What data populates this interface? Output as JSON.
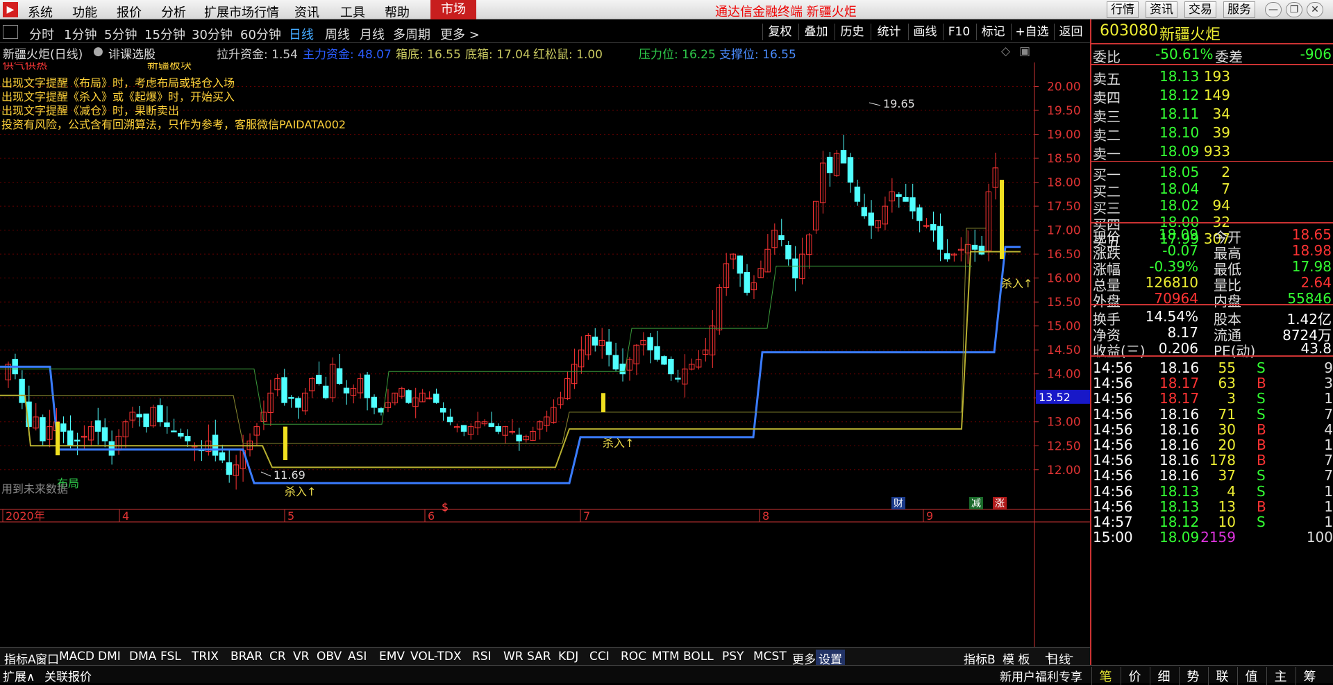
{
  "menubar": {
    "logo": "▶",
    "items": [
      "系统",
      "功能",
      "报价",
      "分析",
      "扩展市场行情",
      "资讯",
      "工具",
      "帮助"
    ],
    "market": "市场",
    "title": "通达信金融终端  新疆火炬",
    "right_buttons": [
      "行情",
      "资讯",
      "交易",
      "服务"
    ],
    "win_controls": [
      "—",
      "❐",
      "✕"
    ]
  },
  "periods": {
    "items": [
      "分时",
      "1分钟",
      "5分钟",
      "15分钟",
      "30分钟",
      "60分钟",
      "日线",
      "周线",
      "月线",
      "多周期",
      "更多 >"
    ],
    "active": "日线"
  },
  "tools": [
    "复权",
    "叠加",
    "历史",
    "统计",
    "画线",
    "F10",
    "标记",
    "+自选",
    "返回"
  ],
  "info": {
    "stock_name": "新疆火炬(日线)",
    "tag": "诽课选股",
    "items": [
      {
        "label": "拉升资金: 1.54",
        "color": "#cccccc"
      },
      {
        "label": "主力资金: 48.07",
        "color": "#2a5cff"
      },
      {
        "label": "箱底: 16.55",
        "color": "#c8c860"
      },
      {
        "label": "底箱: 17.04",
        "color": "#c8c860"
      },
      {
        "label": "红松鼠: 1.00",
        "color": "#c8c860"
      },
      {
        "label": "压力位: 16.25",
        "color": "#2ec84a"
      },
      {
        "label": "支撑位: 16.55",
        "color": "#4a8cff"
      }
    ],
    "sub1": "供气供热",
    "sub2": "新疆板块"
  },
  "notes": [
    "出现文字提醒《布局》时，考虑布局或轻仓入场",
    "出现文字提醒《杀入》或《起爆》时，开始买入",
    "出现文字提醒《减仓》时，果断卖出",
    "投资有风险，公式含有回溯算法，只作为参考，客服微信PAIDATA002"
  ],
  "chart_data": {
    "type": "candlestick",
    "yaxis_ticks": [
      "20.00",
      "19.50",
      "19.00",
      "18.50",
      "18.00",
      "17.50",
      "17.00",
      "16.50",
      "16.00",
      "15.50",
      "15.00",
      "14.50",
      "14.00",
      "13.50",
      "13.00",
      "12.50",
      "12.00"
    ],
    "ylim": [
      11.2,
      20.5
    ],
    "current_price_label": "13.52",
    "high_label": "19.65",
    "low_label": "11.69",
    "month_labels": [
      "2020年",
      "4",
      "5",
      "6",
      "7",
      "8",
      "9"
    ],
    "signals": [
      {
        "text": "布局",
        "color": "#2ec84a"
      },
      {
        "text": "杀入↑",
        "color": "#e8d84a"
      },
      {
        "text": "杀入↑",
        "color": "#e8d84a"
      },
      {
        "text": "杀入↑",
        "color": "#e8d84a"
      }
    ],
    "markers": [
      "财",
      "减",
      "涨"
    ],
    "future_note": "用到未来数据",
    "closes": [
      14.2,
      14.0,
      13.4,
      12.9,
      13.1,
      12.6,
      12.9,
      13.0,
      12.8,
      12.5,
      12.6,
      12.7,
      12.9,
      12.8,
      12.6,
      12.3,
      12.7,
      13.0,
      13.2,
      13.1,
      12.9,
      13.3,
      13.0,
      12.9,
      12.8,
      12.7,
      12.6,
      12.5,
      12.4,
      12.6,
      12.3,
      12.2,
      11.9,
      12.1,
      12.4,
      12.6,
      12.9,
      13.2,
      13.6,
      13.9,
      13.4,
      13.5,
      13.3,
      13.6,
      13.9,
      13.8,
      13.5,
      14.2,
      13.8,
      13.6,
      13.7,
      13.9,
      13.5,
      13.3,
      13.2,
      13.4,
      13.6,
      13.7,
      13.4,
      13.5,
      13.6,
      13.5,
      13.4,
      13.2,
      13.0,
      12.9,
      12.8,
      12.9,
      13.0,
      13.0,
      12.9,
      12.8,
      12.9,
      12.8,
      12.6,
      12.7,
      12.8,
      13.0,
      13.1,
      13.3,
      13.5,
      13.9,
      14.2,
      14.5,
      14.8,
      14.6,
      14.7,
      14.4,
      14.1,
      14.0,
      14.3,
      14.6,
      14.7,
      14.5,
      14.3,
      14.2,
      14.0,
      13.9,
      14.1,
      14.2,
      14.3,
      14.5,
      15.0,
      15.8,
      16.3,
      16.5,
      16.1,
      15.7,
      15.9,
      16.2,
      16.6,
      17.0,
      16.8,
      16.4,
      16.0,
      16.5,
      16.9,
      17.6,
      18.4,
      18.2,
      18.6,
      18.4,
      18.0,
      17.6,
      17.3,
      17.1,
      17.2,
      17.5,
      17.8,
      17.7,
      17.6,
      17.4,
      17.2,
      17.1,
      17.0,
      16.6,
      16.4,
      16.5,
      16.6,
      16.7,
      16.6,
      16.5,
      17.8,
      18.3
    ]
  },
  "quote": {
    "code": "603080",
    "name": "新疆火炬",
    "weibi_label": "委比",
    "weibi": "-50.61%",
    "weicha_label": "委差",
    "weicha": "-906",
    "asks": [
      {
        "label": "卖五",
        "price": "18.13",
        "vol": "193"
      },
      {
        "label": "卖四",
        "price": "18.12",
        "vol": "149"
      },
      {
        "label": "卖三",
        "price": "18.11",
        "vol": "34"
      },
      {
        "label": "卖二",
        "price": "18.10",
        "vol": "39"
      },
      {
        "label": "卖一",
        "price": "18.09",
        "vol": "933"
      }
    ],
    "bids": [
      {
        "label": "买一",
        "price": "18.05",
        "vol": "2"
      },
      {
        "label": "买二",
        "price": "18.04",
        "vol": "7"
      },
      {
        "label": "买三",
        "price": "18.02",
        "vol": "94"
      },
      {
        "label": "买四",
        "price": "18.00",
        "vol": "32"
      },
      {
        "label": "买五",
        "price": "17.99",
        "vol": "307"
      }
    ],
    "stats": [
      {
        "l1": "现价",
        "v1": "18.09",
        "c1": "#3f3",
        "l2": "今开",
        "v2": "18.65",
        "c2": "#f33"
      },
      {
        "l1": "涨跌",
        "v1": "-0.07",
        "c1": "#3f3",
        "l2": "最高",
        "v2": "18.98",
        "c2": "#f33"
      },
      {
        "l1": "涨幅",
        "v1": "-0.39%",
        "c1": "#3f3",
        "l2": "最低",
        "v2": "17.98",
        "c2": "#3f3"
      },
      {
        "l1": "总量",
        "v1": "126810",
        "c1": "#ee3",
        "l2": "量比",
        "v2": "2.64",
        "c2": "#f33"
      },
      {
        "l1": "外盘",
        "v1": "70964",
        "c1": "#f33",
        "l2": "内盘",
        "v2": "55846",
        "c2": "#3f3"
      }
    ],
    "fund": [
      {
        "l1": "换手",
        "v1": "14.54%",
        "l2": "股本",
        "v2": "1.42亿"
      },
      {
        "l1": "净资",
        "v1": "8.17",
        "l2": "流通",
        "v2": "8724万"
      },
      {
        "l1": "收益(三)",
        "v1": "0.206",
        "l2": "PE(动)",
        "v2": "43.8"
      }
    ],
    "ticks": [
      {
        "t": "14:56",
        "p": "18.16",
        "pc": "#fff",
        "v": "55",
        "s": "S",
        "n": "9"
      },
      {
        "t": "14:56",
        "p": "18.17",
        "pc": "#f33",
        "v": "63",
        "s": "B",
        "n": "3"
      },
      {
        "t": "14:56",
        "p": "18.17",
        "pc": "#f33",
        "v": "3",
        "s": "S",
        "n": "1"
      },
      {
        "t": "14:56",
        "p": "18.16",
        "pc": "#fff",
        "v": "71",
        "s": "S",
        "n": "7"
      },
      {
        "t": "14:56",
        "p": "18.16",
        "pc": "#fff",
        "v": "30",
        "s": "B",
        "n": "4"
      },
      {
        "t": "14:56",
        "p": "18.16",
        "pc": "#fff",
        "v": "20",
        "s": "B",
        "n": "1"
      },
      {
        "t": "14:56",
        "p": "18.16",
        "pc": "#fff",
        "v": "178",
        "s": "B",
        "n": "7"
      },
      {
        "t": "14:56",
        "p": "18.16",
        "pc": "#fff",
        "v": "37",
        "s": "S",
        "n": "7"
      },
      {
        "t": "14:56",
        "p": "18.13",
        "pc": "#3f3",
        "v": "4",
        "s": "S",
        "n": "1"
      },
      {
        "t": "14:56",
        "p": "18.13",
        "pc": "#3f3",
        "v": "13",
        "s": "B",
        "n": "1"
      },
      {
        "t": "14:57",
        "p": "18.12",
        "pc": "#3f3",
        "v": "10",
        "s": "S",
        "n": "1"
      },
      {
        "t": "15:00",
        "p": "18.09",
        "pc": "#3f3",
        "v": "2159",
        "s": "",
        "n": "100"
      }
    ]
  },
  "bottom_tabs": [
    "指标A",
    "窗口",
    "MACD",
    "DMI",
    "DMA",
    "FSL",
    "TRIX",
    "BRAR",
    "CR",
    "VR",
    "OBV",
    "ASI",
    "EMV",
    "VOL-TDX",
    "RSI",
    "WR",
    "SAR",
    "KDJ",
    "CCI",
    "ROC",
    "MTM",
    "BOLL",
    "PSY",
    "MCST",
    "更多",
    "设置",
    "指标B",
    "模 板",
    "+",
    "-"
  ],
  "period_tab": "日线",
  "status": {
    "left": "扩展∧",
    "left2": "关联报价",
    "promo": "新用户福利专享"
  },
  "right_bottom_tabs": [
    "笔",
    "价",
    "细",
    "势",
    "联",
    "值",
    "主",
    "筹"
  ]
}
